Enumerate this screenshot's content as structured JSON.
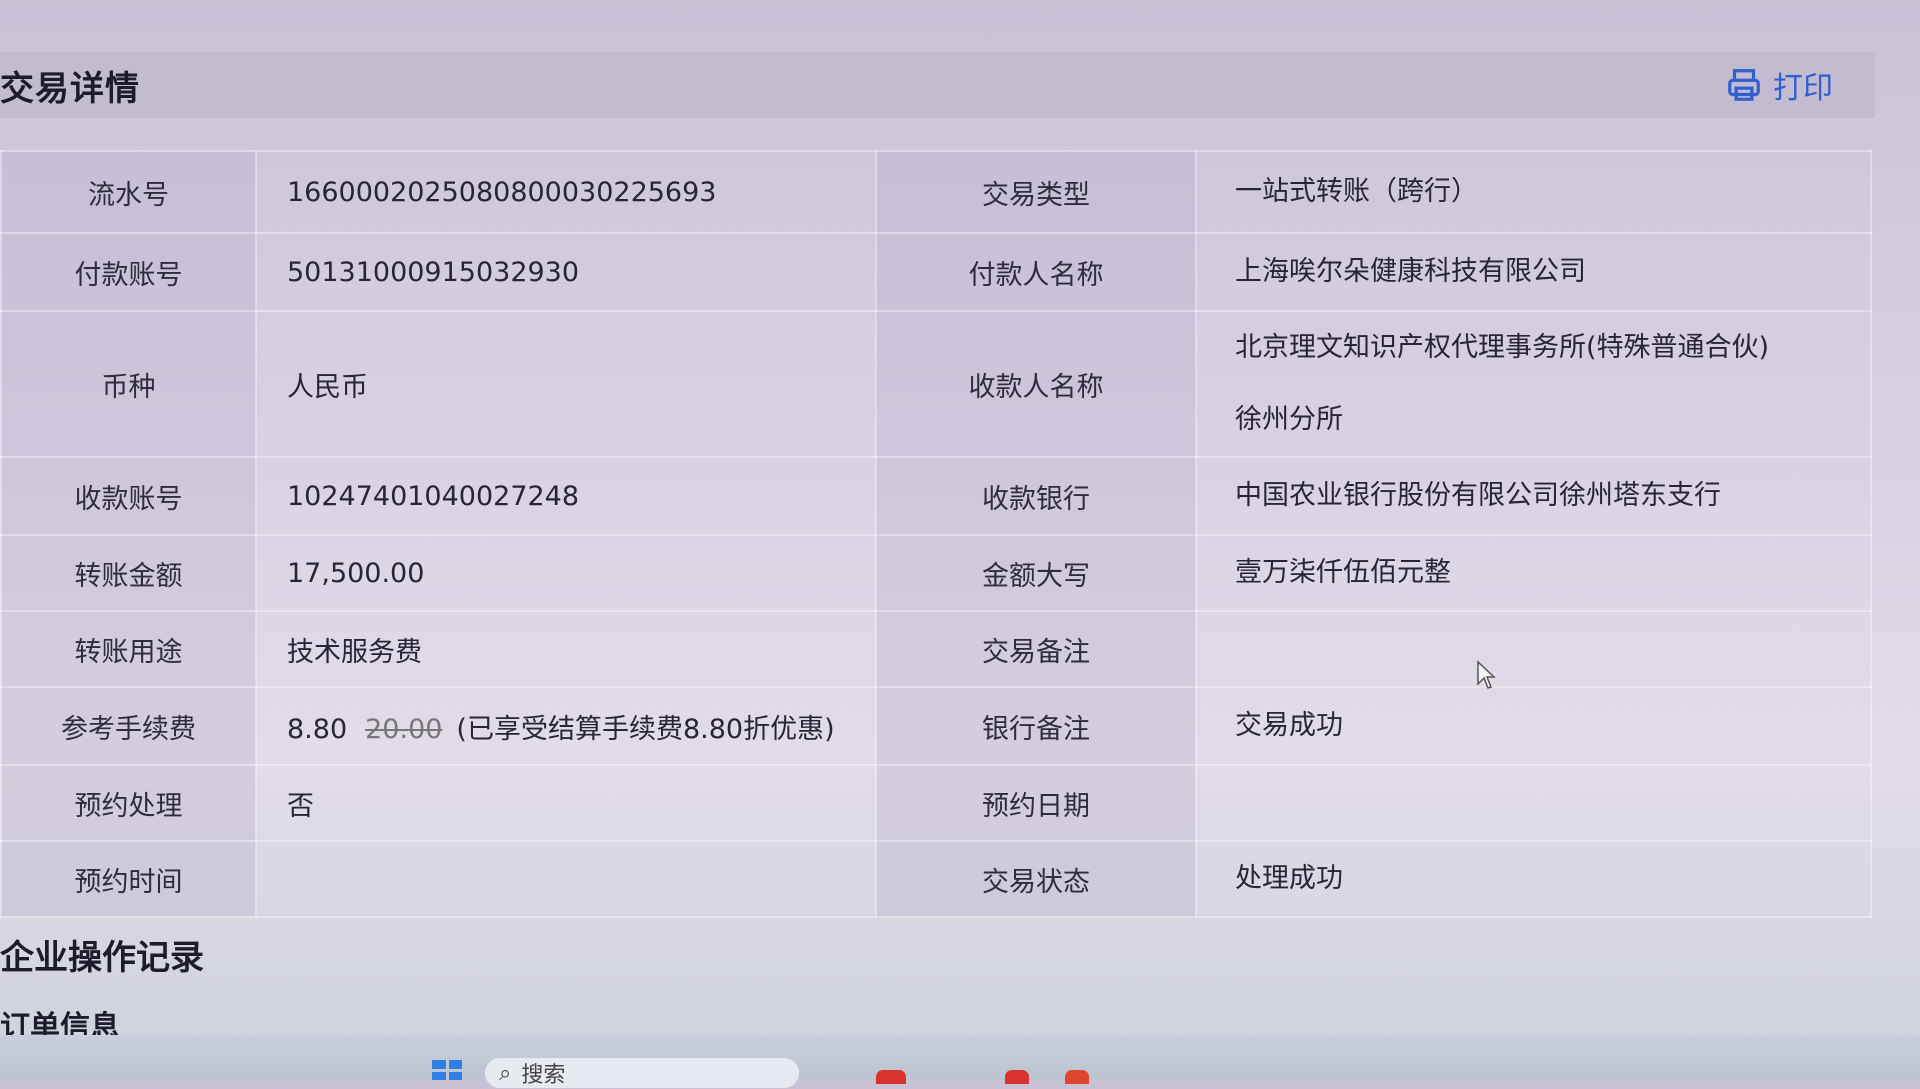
{
  "header": {
    "title": "交易详情",
    "print_label": "打印"
  },
  "rows": [
    {
      "left_label": "流水号",
      "left_value": "16600020250808000302256​93",
      "right_label": "交易类型",
      "right_value": "一站式转账（跨行）"
    },
    {
      "left_label": "付款账号",
      "left_value": "50131000915032930",
      "right_label": "付款人名称",
      "right_value": "上海唉尔朵健康科技有限公司"
    },
    {
      "left_label": "币种",
      "left_value": "人民币",
      "right_label": "收款人名称",
      "right_value_line1": "北京理文知识产权代理事务所(特殊普通合伙)",
      "right_value_line2": "徐州分所"
    },
    {
      "left_label": "收款账号",
      "left_value": "10247401040027248",
      "right_label": "收款银行",
      "right_value": "中国农业银行股份有限公司徐州塔东支行"
    },
    {
      "left_label": "转账金额",
      "left_value": "17,500.00",
      "right_label": "金额大写",
      "right_value": "壹万柒仟伍佰元整"
    },
    {
      "left_label": "转账用途",
      "left_value": "技术服务费",
      "right_label": "交易备注",
      "right_value": ""
    },
    {
      "left_label": "参考手续费",
      "fee_actual": "8.80",
      "fee_original": "20.00",
      "fee_note": "(已享受结算手续费8.80折优惠)",
      "right_label": "银行备注",
      "right_value": "交易成功"
    },
    {
      "left_label": "预约处理",
      "left_value": "否",
      "right_label": "预约日期",
      "right_value": ""
    },
    {
      "left_label": "预约时间",
      "left_value": "",
      "right_label": "交易状态",
      "right_value": "处理成功"
    }
  ],
  "sections": {
    "operation_log": "企业操作记录",
    "order_info": "订单信息"
  },
  "taskbar": {
    "search_label": "搜索"
  },
  "colors": {
    "accent": "#2f5fd0"
  }
}
